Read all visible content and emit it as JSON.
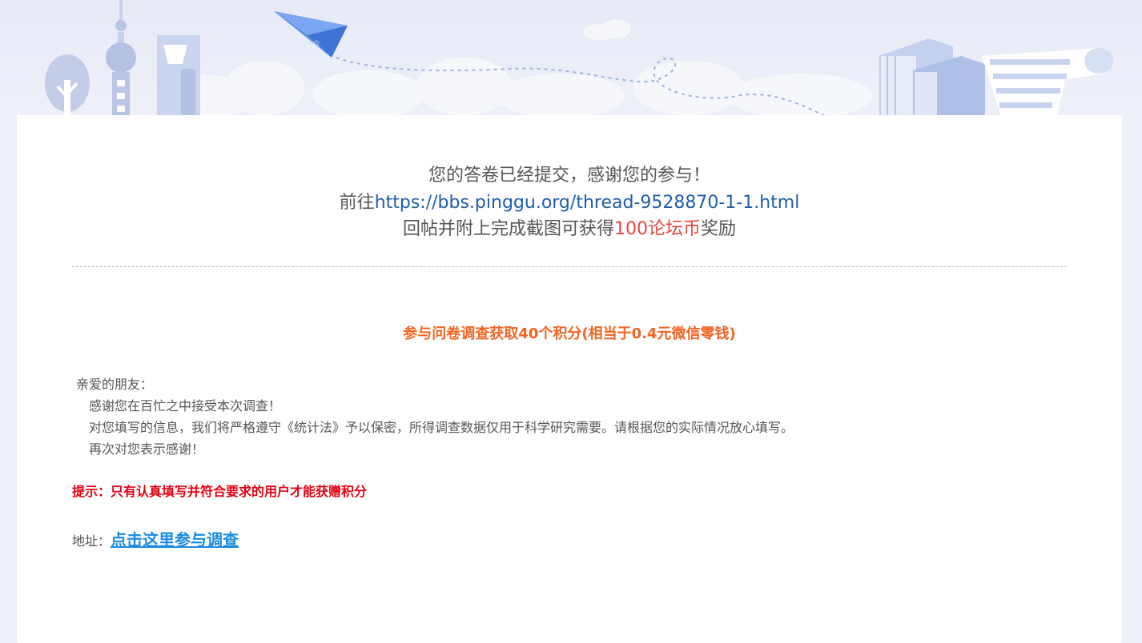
{
  "message": {
    "line1": "您的答卷已经提交，感谢您的参与！",
    "line2_prefix": "前往",
    "line2_link": "https://bbs.pinggu.org/thread-9528870-1-1.html",
    "line3_prefix": "回帖并附上完成截图可获得",
    "line3_highlight": "100论坛币",
    "line3_suffix": "奖励"
  },
  "survey": {
    "title": "参与问卷调查获取40个积分(相当于0.4元微信零钱)",
    "greeting": "亲爱的朋友：",
    "body_lines": [
      "感谢您在百忙之中接受本次调查！",
      "对您填写的信息，我们将严格遵守《统计法》予以保密，所得调查数据仅用于科学研究需要。请根据您的实际情况放心填写。",
      "再次对您表示感谢！"
    ],
    "tip": "提示：只有认真填写并符合要求的用户才能获赠积分",
    "address_label": "地址：",
    "address_link": "点击这里参与调查"
  },
  "colors": {
    "accent_orange": "#f26522",
    "tip_red": "#e60012",
    "link_blue": "#1a8be0",
    "url_blue": "#1f5ea8",
    "highlight_red": "#ee4444"
  },
  "icons": [
    "tree-icon",
    "tv-tower-icon",
    "skyscraper-icon",
    "paper-plane-icon",
    "books-icon",
    "scroll-icon"
  ]
}
